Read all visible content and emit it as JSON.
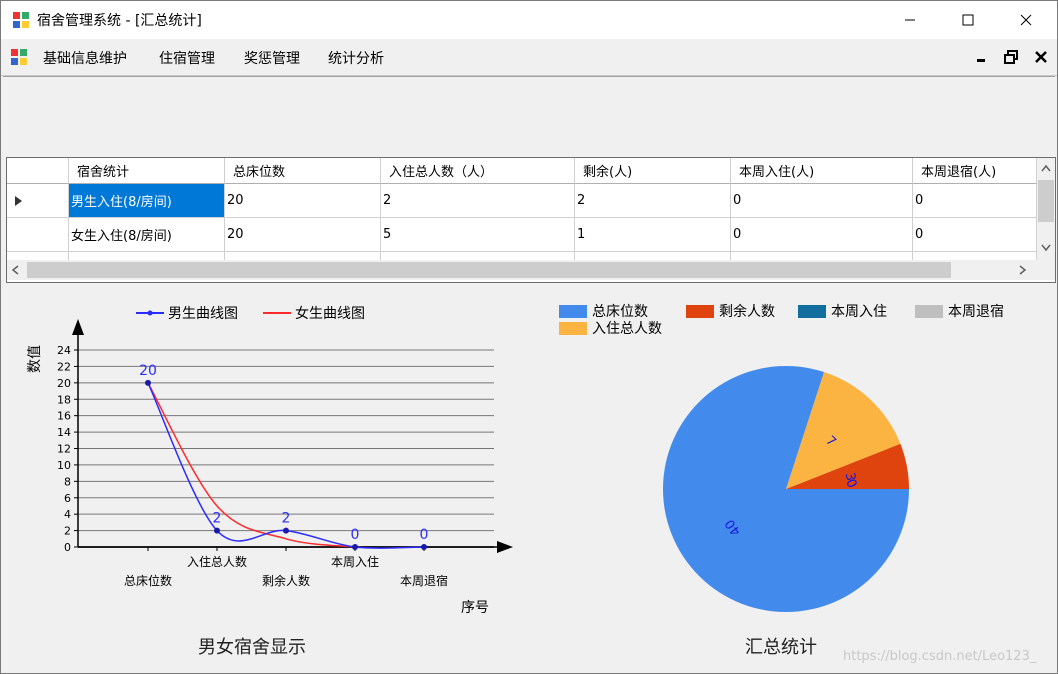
{
  "window": {
    "title": "宿舍管理系统 - [汇总统计]",
    "controls": [
      "minimize",
      "maximize",
      "close"
    ]
  },
  "menu": {
    "items": [
      "基础信息维护",
      "住宿管理",
      "奖惩管理",
      "统计分析"
    ]
  },
  "grid": {
    "headers": [
      "宿舍统计",
      "总床位数",
      "入住总人数（人）",
      "剩余(人)",
      "本周入住(人)",
      "本周退宿(人)"
    ],
    "rows": [
      [
        "男生入住(8/房间)",
        "20",
        "2",
        "2",
        "0",
        "0"
      ],
      [
        "女生入住(8/房间)",
        "20",
        "5",
        "1",
        "0",
        "0"
      ]
    ],
    "selected_row": 0
  },
  "chart_data": [
    {
      "type": "line",
      "title": "男女宿舍显示",
      "xlabel": "序号",
      "ylabel": "数值",
      "categories": [
        "总床位数",
        "入住总人数",
        "剩余人数",
        "本周入住",
        "本周退宿"
      ],
      "ylim": [
        0,
        24
      ],
      "yticks": [
        0,
        2,
        4,
        6,
        8,
        10,
        12,
        14,
        16,
        18,
        20,
        22,
        24
      ],
      "grid": true,
      "legend": "top",
      "series": [
        {
          "name": "男生曲线图",
          "color": "#2b2bff",
          "values": [
            20,
            2,
            2,
            0,
            0
          ],
          "labels": [
            "20",
            "2",
            "2",
            "0",
            "0"
          ],
          "markers": true
        },
        {
          "name": "女生曲线图",
          "color": "#ff2b2b",
          "values": [
            20,
            5,
            1,
            0,
            null
          ],
          "markers": false
        }
      ]
    },
    {
      "type": "pie",
      "title": "汇总统计",
      "legend": "top",
      "labels": [
        "总床位数",
        "剩余人数",
        "本周入住",
        "本周退宿",
        "入住总人数"
      ],
      "colors": [
        "#428bed",
        "#e0440e",
        "#136ea0",
        "#bfbfbf",
        "#fbb441"
      ],
      "values": [
        40,
        3,
        0,
        0,
        7
      ],
      "value_labels": [
        "40",
        "3",
        "0",
        "0",
        "7"
      ]
    }
  ],
  "watermark": "https://blog.csdn.net/Leo123_"
}
